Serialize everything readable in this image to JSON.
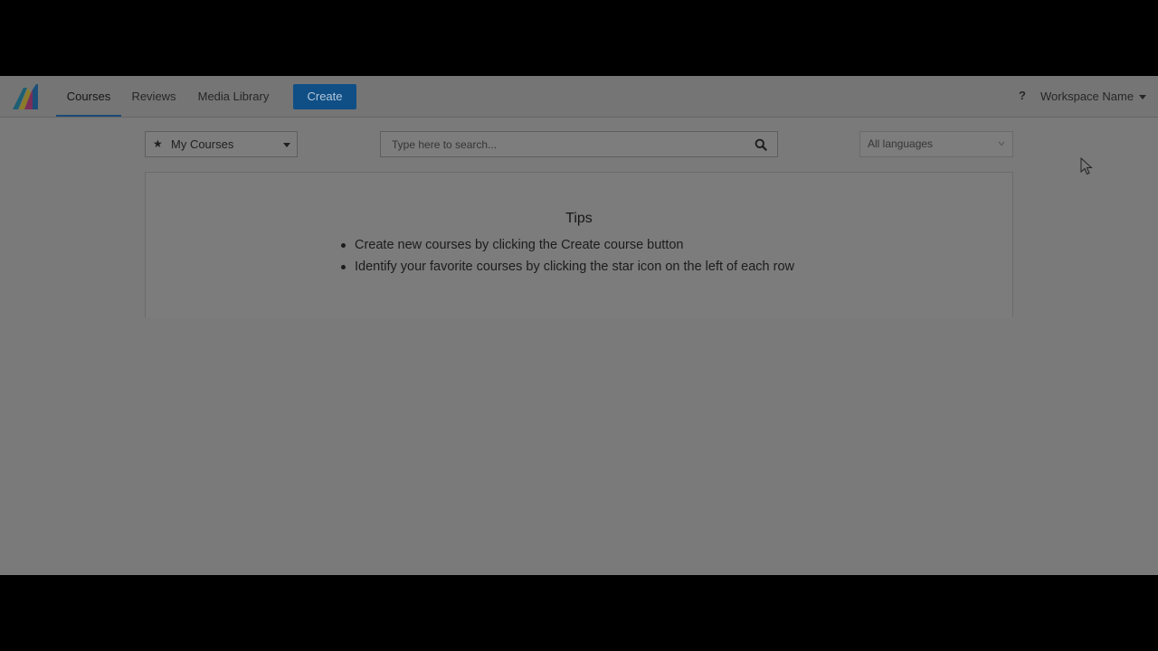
{
  "navbar": {
    "tabs": [
      {
        "label": "Courses",
        "active": true
      },
      {
        "label": "Reviews",
        "active": false
      },
      {
        "label": "Media Library",
        "active": false
      }
    ],
    "create_label": "Create",
    "help_icon": "?",
    "workspace_label": "Workspace Name"
  },
  "filters": {
    "my_courses_label": "My Courses",
    "search_placeholder": "Type here to search...",
    "language_label": "All languages"
  },
  "tips": {
    "title": "Tips",
    "items": [
      "Create new courses by clicking the Create course button",
      "Identify your favorite courses by clicking the star icon on the left of each row"
    ]
  },
  "colors": {
    "accent": "#0f4f86",
    "letterbox": "#000000",
    "dimmed_background": "#7a7a7a"
  }
}
